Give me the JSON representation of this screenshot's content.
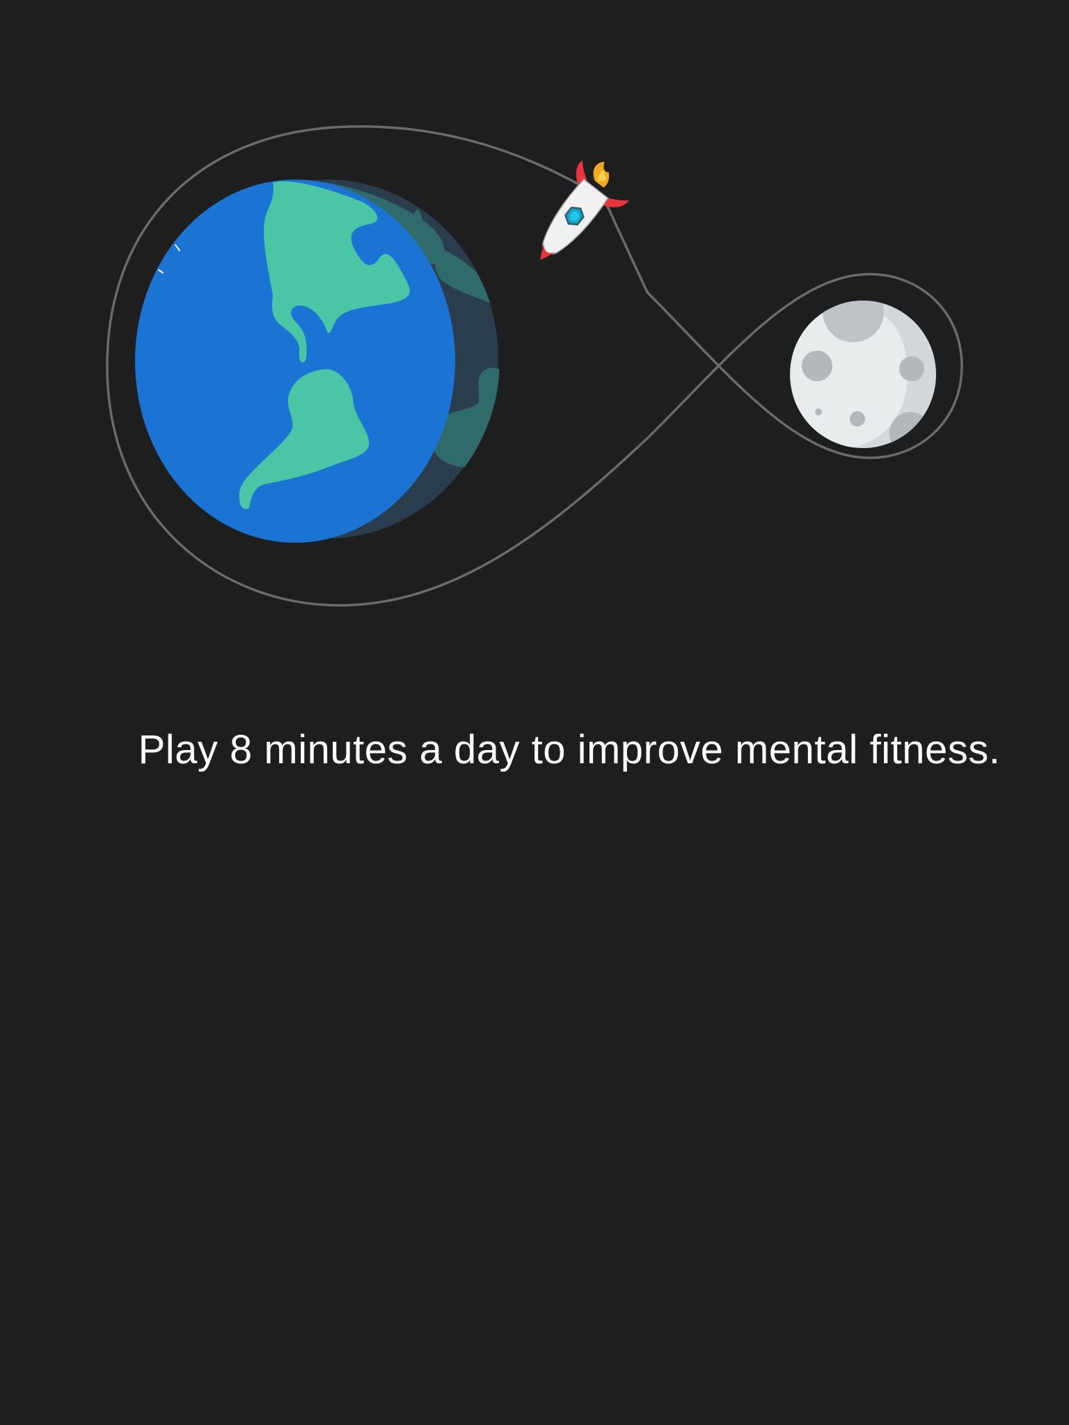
{
  "screen": {
    "background_color": "#1e1e1e",
    "illustration": {
      "earth_icon": "earth-globe-icon",
      "moon_icon": "moon-icon",
      "rocket_icon": "rocket-icon",
      "orbit": "infinity-orbit-path",
      "colors": {
        "ocean": "#1b74d4",
        "land": "#4ac6a6",
        "earth_shadow": "#2a3d4e",
        "moon": "#e9ecec",
        "moon_crater": "#b4b8bd",
        "rocket_body": "#f1f1f1",
        "rocket_fin": "#e8373a",
        "rocket_flame": "#f3a81f",
        "rocket_window": "#12a5c9",
        "orbit_stroke": "#6b6b6b"
      }
    },
    "tagline": "Play 8 minutes a day to improve mental fitness."
  }
}
